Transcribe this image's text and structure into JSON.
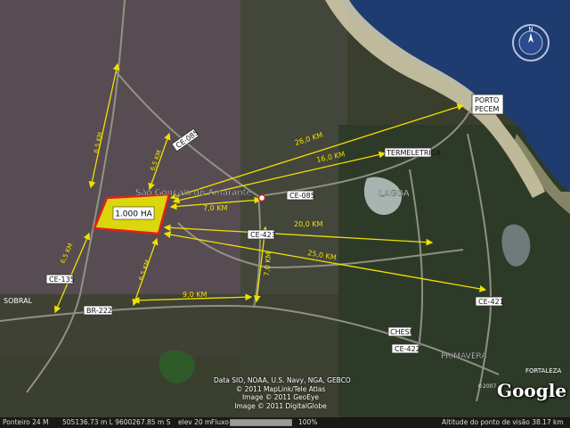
{
  "map": {
    "places": {
      "sao_goncalo": "São Gonçalo do Amarante",
      "lagoa": "LAGOA",
      "primavera": "PRIMAVERA",
      "porto_pecem": [
        "PORTO",
        "PECEM"
      ],
      "termeletrica": "TERMELETRICA",
      "sobral": "SOBRAL",
      "chesf": "CHESF",
      "fortaleza": "FORTALEZA"
    },
    "area_label": "1.000 HA",
    "roads": [
      "CE-085",
      "CE-085",
      "CE-423",
      "CE-135",
      "BR-222",
      "CE-421",
      "CE-422"
    ],
    "distances": {
      "d26": "26,0 KM",
      "d16": "16,0 KM",
      "d7h": "7,0 KM",
      "d20": "20,0 KM",
      "d25": "25,0 KM",
      "d9": "9,0 KM",
      "d7v": "7,0 KM",
      "d65a": "6,5 KM",
      "d65b": "6,5 KM",
      "d65c": "6,5 KM",
      "d65d": "6,5 KM"
    }
  },
  "copyright": [
    "Data SIO, NOAA, U.S. Navy, NGA, GEBCO",
    "© 2011 MapLink/Tele Atlas",
    "Image © 2011 GeoEye",
    "Image © 2011 DigitalGlobe"
  ],
  "logo": {
    "text": "Google",
    "year": "©2007"
  },
  "compass": {
    "north_letter": "N"
  },
  "status_bar": {
    "pointer": "Ponteiro 24 M",
    "coords": "505136.73 m L  9600267.85 m S",
    "elev": "elev   20 m",
    "stream_label": "Fluxo",
    "stream_pct": "100%",
    "stream_fraction": 1.0,
    "eye_alt": "Altitude do ponto de visão    38.17 km"
  },
  "colors": {
    "annotation": "#f0e000",
    "area_fill": "#f2f000",
    "area_border": "#e02020",
    "ocean": "#1e3c70"
  }
}
